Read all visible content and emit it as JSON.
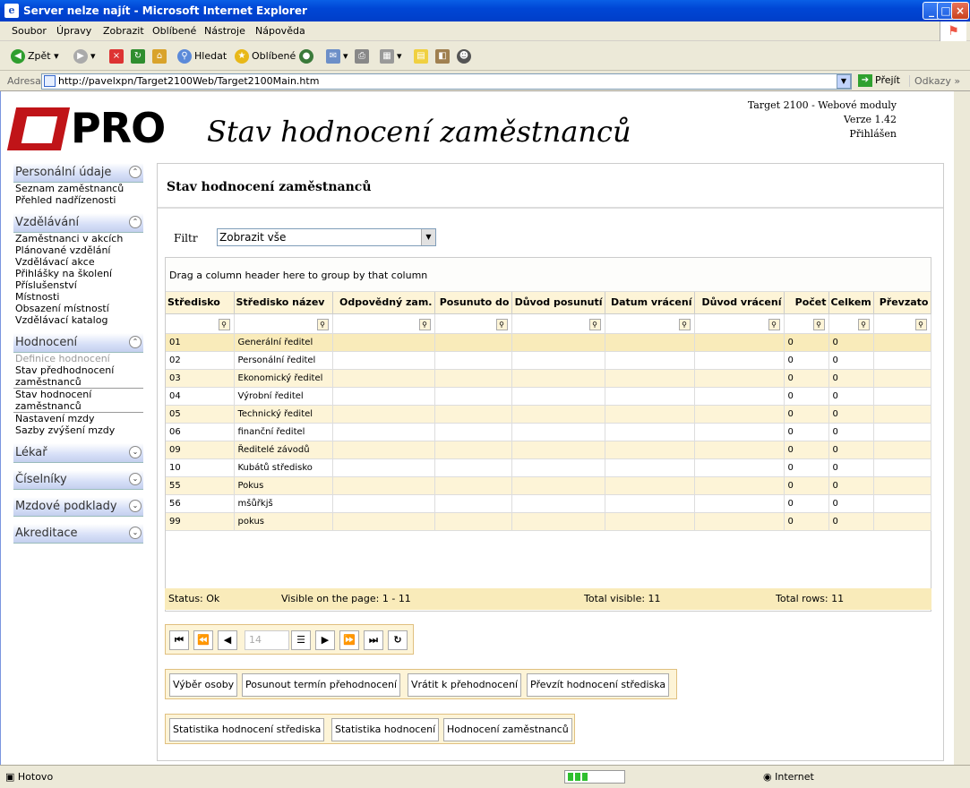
{
  "window": {
    "title": "Server nelze najít - Microsoft Internet Explorer"
  },
  "menu": [
    "Soubor",
    "Úpravy",
    "Zobrazit",
    "Oblíbené",
    "Nástroje",
    "Nápověda"
  ],
  "toolbar": {
    "back": "Zpět",
    "search": "Hledat",
    "favorites": "Oblíbené"
  },
  "address": {
    "label": "Adresa",
    "url": "http://pavelxpn/Target2100Web/Target2100Main.htm",
    "go": "Přejít",
    "links": "Odkazy"
  },
  "header": {
    "logo_text": "PRO",
    "title": "Stav hodnocení zaměstnanců",
    "product": "Target 2100 - Webové moduly",
    "version": "Verze 1.42",
    "login": "Přihlášen"
  },
  "sidebar": {
    "sections": [
      {
        "title": "Personální údaje",
        "items": [
          "Seznam zaměstnanců",
          "Přehled nadřízenosti"
        ]
      },
      {
        "title": "Vzdělávání",
        "items": [
          "Zaměstnanci v akcích",
          "Plánované vzdělání",
          "Vzdělávací akce",
          "Přihlášky na školení",
          "Příslušenství",
          "Místnosti",
          "Obsazení místností",
          "Vzdělávací katalog"
        ]
      },
      {
        "title": "Hodnocení",
        "items": [
          "Definice hodnocení",
          "Stav předhodnocení zaměstnanců",
          "Stav hodnocení zaměstnanců",
          "Nastavení mzdy",
          "Sazby zvýšení mzdy"
        ]
      },
      {
        "title": "Lékař",
        "items": []
      },
      {
        "title": "Číselníky",
        "items": []
      },
      {
        "title": "Mzdové podklady",
        "items": []
      },
      {
        "title": "Akreditace",
        "items": []
      }
    ]
  },
  "content": {
    "heading": "Stav hodnocení zaměstnanců",
    "filter_label": "Filtr",
    "filter_value": "Zobrazit vše",
    "group_hint": "Drag a column header here to group by that column",
    "columns": [
      "Středisko",
      "Středisko název",
      "Odpovědný zam.",
      "Posunuto do",
      "Důvod posunutí",
      "Datum vrácení",
      "Důvod vrácení",
      "Počet",
      "Celkem",
      "Převzato"
    ],
    "rows": [
      [
        "01",
        "Generální ředitel",
        "",
        "",
        "",
        "",
        "",
        "0",
        "0",
        ""
      ],
      [
        "02",
        "Personální ředitel",
        "",
        "",
        "",
        "",
        "",
        "0",
        "0",
        ""
      ],
      [
        "03",
        "Ekonomický ředitel",
        "",
        "",
        "",
        "",
        "",
        "0",
        "0",
        ""
      ],
      [
        "04",
        "Výrobní ředitel",
        "",
        "",
        "",
        "",
        "",
        "0",
        "0",
        ""
      ],
      [
        "05",
        "Technický ředitel",
        "",
        "",
        "",
        "",
        "",
        "0",
        "0",
        ""
      ],
      [
        "06",
        "finanční ředitel",
        "",
        "",
        "",
        "",
        "",
        "0",
        "0",
        ""
      ],
      [
        "09",
        "Ředitelé závodů",
        "",
        "",
        "",
        "",
        "",
        "0",
        "0",
        ""
      ],
      [
        "10",
        "Kubátů středisko",
        "",
        "",
        "",
        "",
        "",
        "0",
        "0",
        ""
      ],
      [
        "55",
        "Pokus",
        "",
        "",
        "",
        "",
        "",
        "0",
        "0",
        ""
      ],
      [
        "56",
        "mšůřkjš",
        "",
        "",
        "",
        "",
        "",
        "0",
        "0",
        ""
      ],
      [
        "99",
        "pokus",
        "",
        "",
        "",
        "",
        "",
        "0",
        "0",
        ""
      ]
    ],
    "status": {
      "status": "Status: Ok",
      "visible_page": "Visible on the page: 1 - 11",
      "total_visible": "Total visible: 11",
      "total_rows": "Total rows: 11"
    },
    "pager_value": "14",
    "buttons_row1": [
      "Výběr osoby",
      "Posunout termín přehodnocení",
      "Vrátit k přehodnocení",
      "Převzít hodnocení střediska"
    ],
    "buttons_row2": [
      "Statistika hodnocení střediska",
      "Statistika hodnocení",
      "Hodnocení zaměstnanců"
    ]
  },
  "statusbar": {
    "left": "Hotovo",
    "zone": "Internet"
  }
}
